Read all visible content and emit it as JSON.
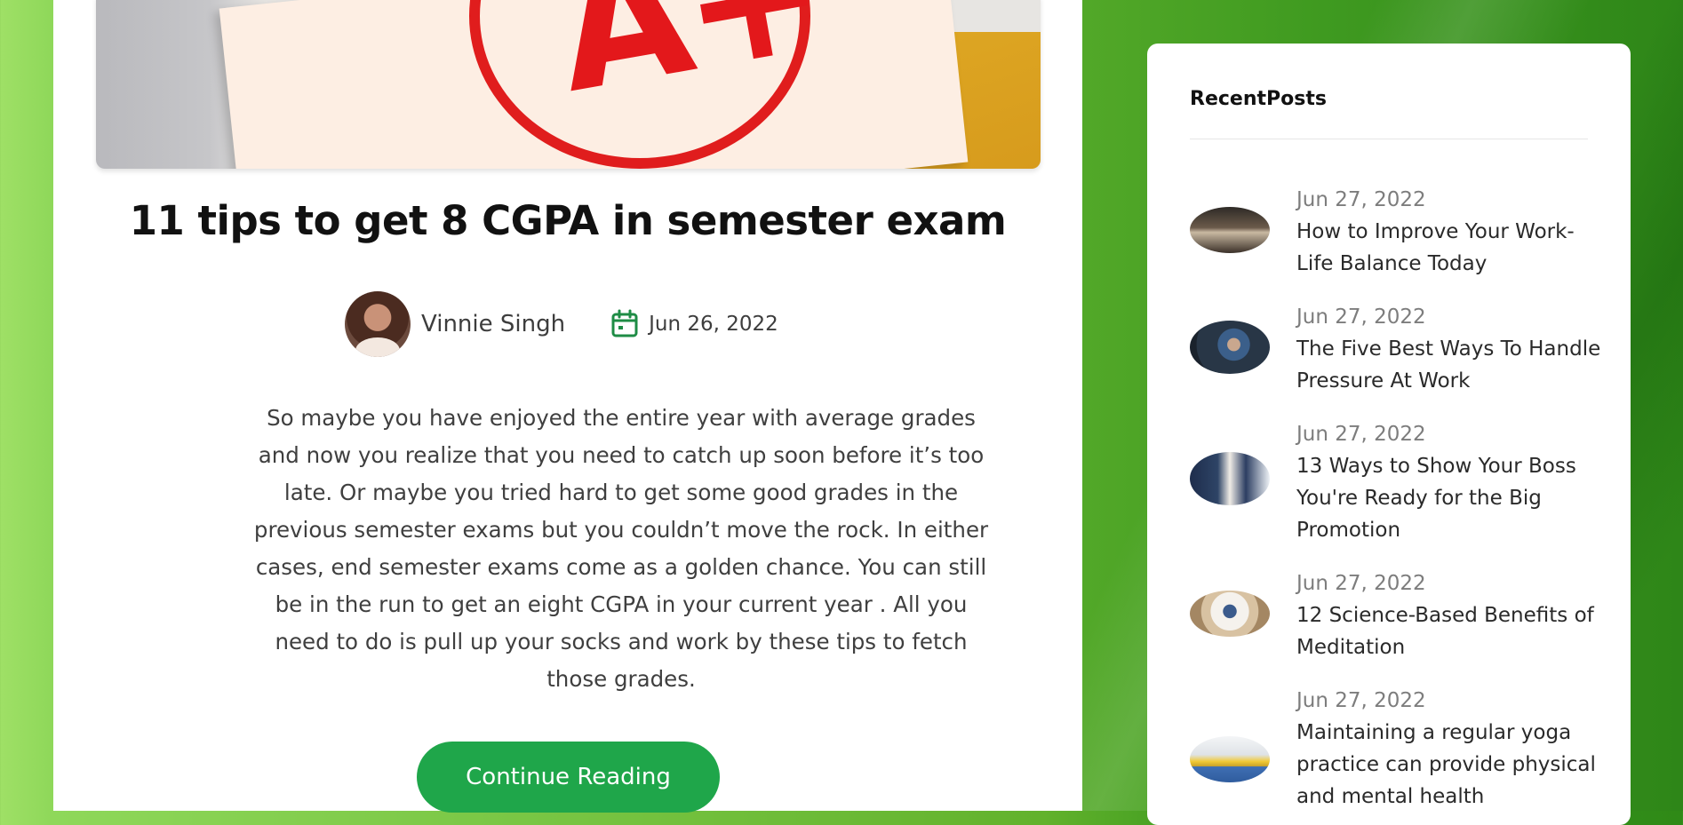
{
  "post": {
    "title": "11 tips to get 8 CGPA in semester exam",
    "author": "Vinnie Singh",
    "date": "Jun 26, 2022",
    "excerpt": "So maybe you have enjoyed the entire year with average grades and now you realize that you need to catch up soon before it’s too late. Or maybe you tried hard to get some good grades in the previous semester exams but you couldn’t move the rock. In either cases, end semester exams come as a golden chance. You can still be in the run to get an eight CGPA in your current year . All you need to do is pull up your socks and work by these tips to fetch those grades.",
    "button_label": "Continue Reading",
    "hero_text": "A+"
  },
  "sidebar": {
    "heading": "RecentPosts",
    "items": [
      {
        "date": "Jun 27, 2022",
        "title": "How to Improve Your Work-Life Balance Today"
      },
      {
        "date": "Jun 27, 2022",
        "title": "The Five Best Ways To Handle Pressure At Work"
      },
      {
        "date": "Jun 27, 2022",
        "title": "13 Ways to Show Your Boss You're Ready for the Big Promotion"
      },
      {
        "date": "Jun 27, 2022",
        "title": "12 Science-Based Benefits of Meditation"
      },
      {
        "date": "Jun 27, 2022",
        "title": "Maintaining a regular yoga practice can provide physical and mental health"
      }
    ]
  },
  "colors": {
    "accent_green": "#1fa64a",
    "icon_green": "#1e8c45",
    "grade_red": "#e3181b"
  },
  "icons": {
    "calendar": "calendar-icon"
  }
}
